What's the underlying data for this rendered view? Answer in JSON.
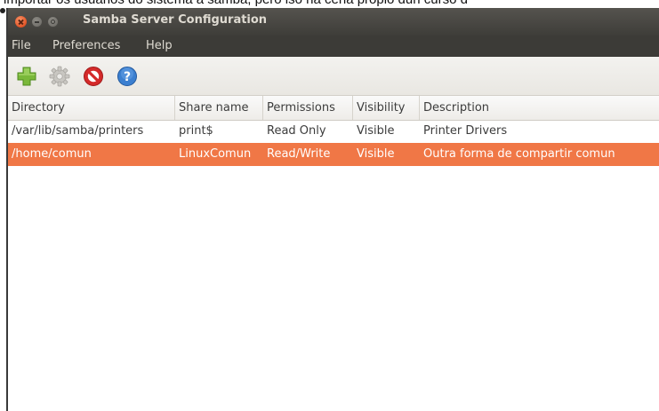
{
  "background_caption": "importar os usuarios do sistema a samba, pero iso na cena propio dun curso d",
  "window": {
    "title": "Samba Server Configuration"
  },
  "menu": {
    "items": [
      {
        "label": "File"
      },
      {
        "label": "Preferences"
      },
      {
        "label": "Help"
      }
    ]
  },
  "toolbar": {
    "buttons": [
      {
        "icon": "add-share-icon",
        "color": "#7ab83a"
      },
      {
        "icon": "properties-gear-icon",
        "color": "#b8b6b1"
      },
      {
        "icon": "delete-share-icon",
        "color": "#d42a2a"
      },
      {
        "icon": "help-icon",
        "color": "#3b7fd0"
      }
    ]
  },
  "table": {
    "columns": [
      "Directory",
      "Share name",
      "Permissions",
      "Visibility",
      "Description"
    ],
    "rows": [
      {
        "cells": [
          "/var/lib/samba/printers",
          "print$",
          "Read Only",
          "Visible",
          "Printer Drivers"
        ],
        "selected": false
      },
      {
        "cells": [
          "/home/comun",
          "LinuxComun",
          "Read/Write",
          "Visible",
          "Outra forma de compartir comun"
        ],
        "selected": true
      }
    ]
  },
  "colors": {
    "selection": "#f07746",
    "titlebar": "#3e3d39",
    "menubar": "#3c3b37"
  }
}
